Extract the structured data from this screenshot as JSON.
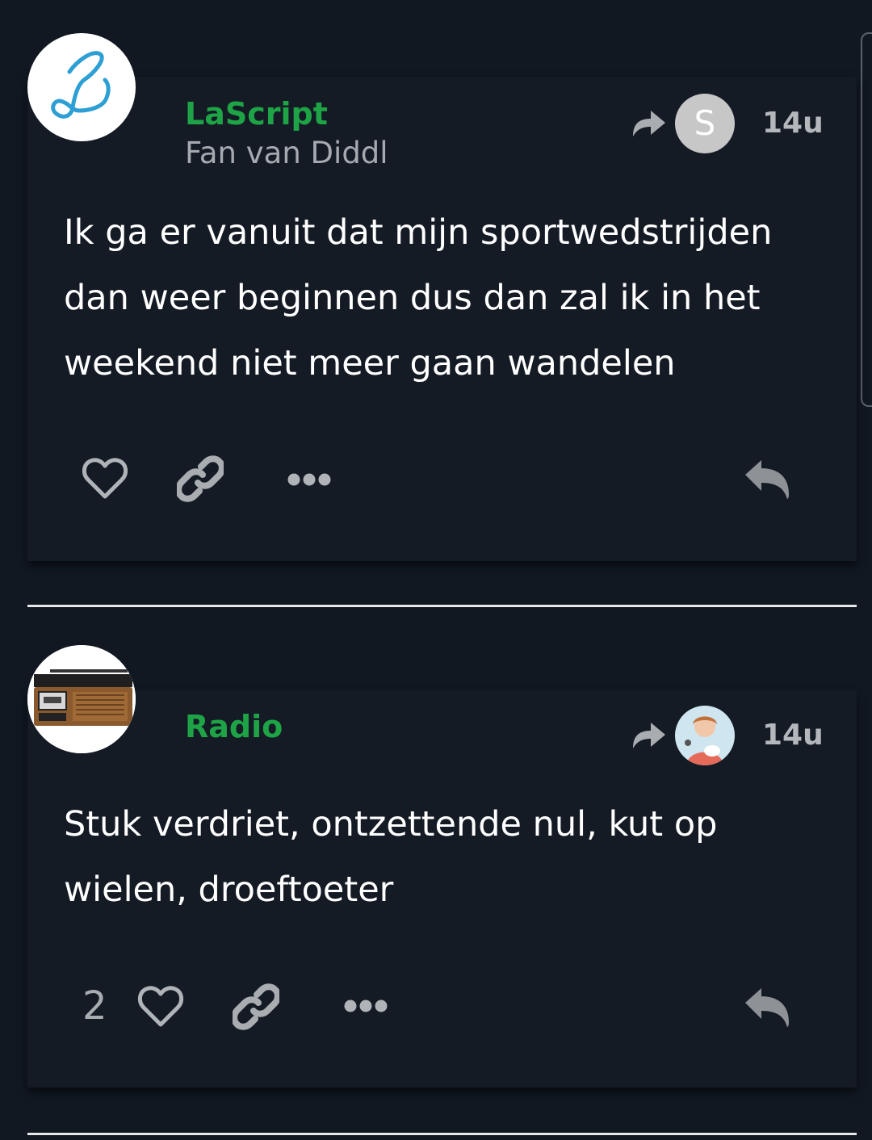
{
  "posts": [
    {
      "username": "LaScript",
      "user_title": "Fan van Diddl",
      "avatar_icon": "script-l-logo-icon",
      "reply_to": {
        "avatar_letter": "S",
        "icon": "share-arrow-icon"
      },
      "timestamp": "14u",
      "body": "Ik ga er vanuit dat mijn sportwedstrijden dan weer beginnen dus dan zal ik in het weekend niet meer gaan wandelen",
      "like_count": "",
      "actions": [
        "heart-icon",
        "link-icon",
        "more-icon",
        "reply-icon"
      ]
    },
    {
      "username": "Radio",
      "user_title": "",
      "avatar_icon": "cassette-radio-icon",
      "reply_to": {
        "avatar_letter": "",
        "icon": "share-arrow-icon"
      },
      "timestamp": "14u",
      "body": "Stuk verdriet, ontzettende nul, kut op wielen, droeftoeter",
      "like_count": "2",
      "actions": [
        "heart-icon",
        "link-icon",
        "more-icon",
        "reply-icon"
      ]
    }
  ],
  "colors": {
    "background": "#111822",
    "card": "#141b25",
    "username": "#1ea446",
    "muted": "#a6aab0",
    "icon": "#a9acb0"
  }
}
